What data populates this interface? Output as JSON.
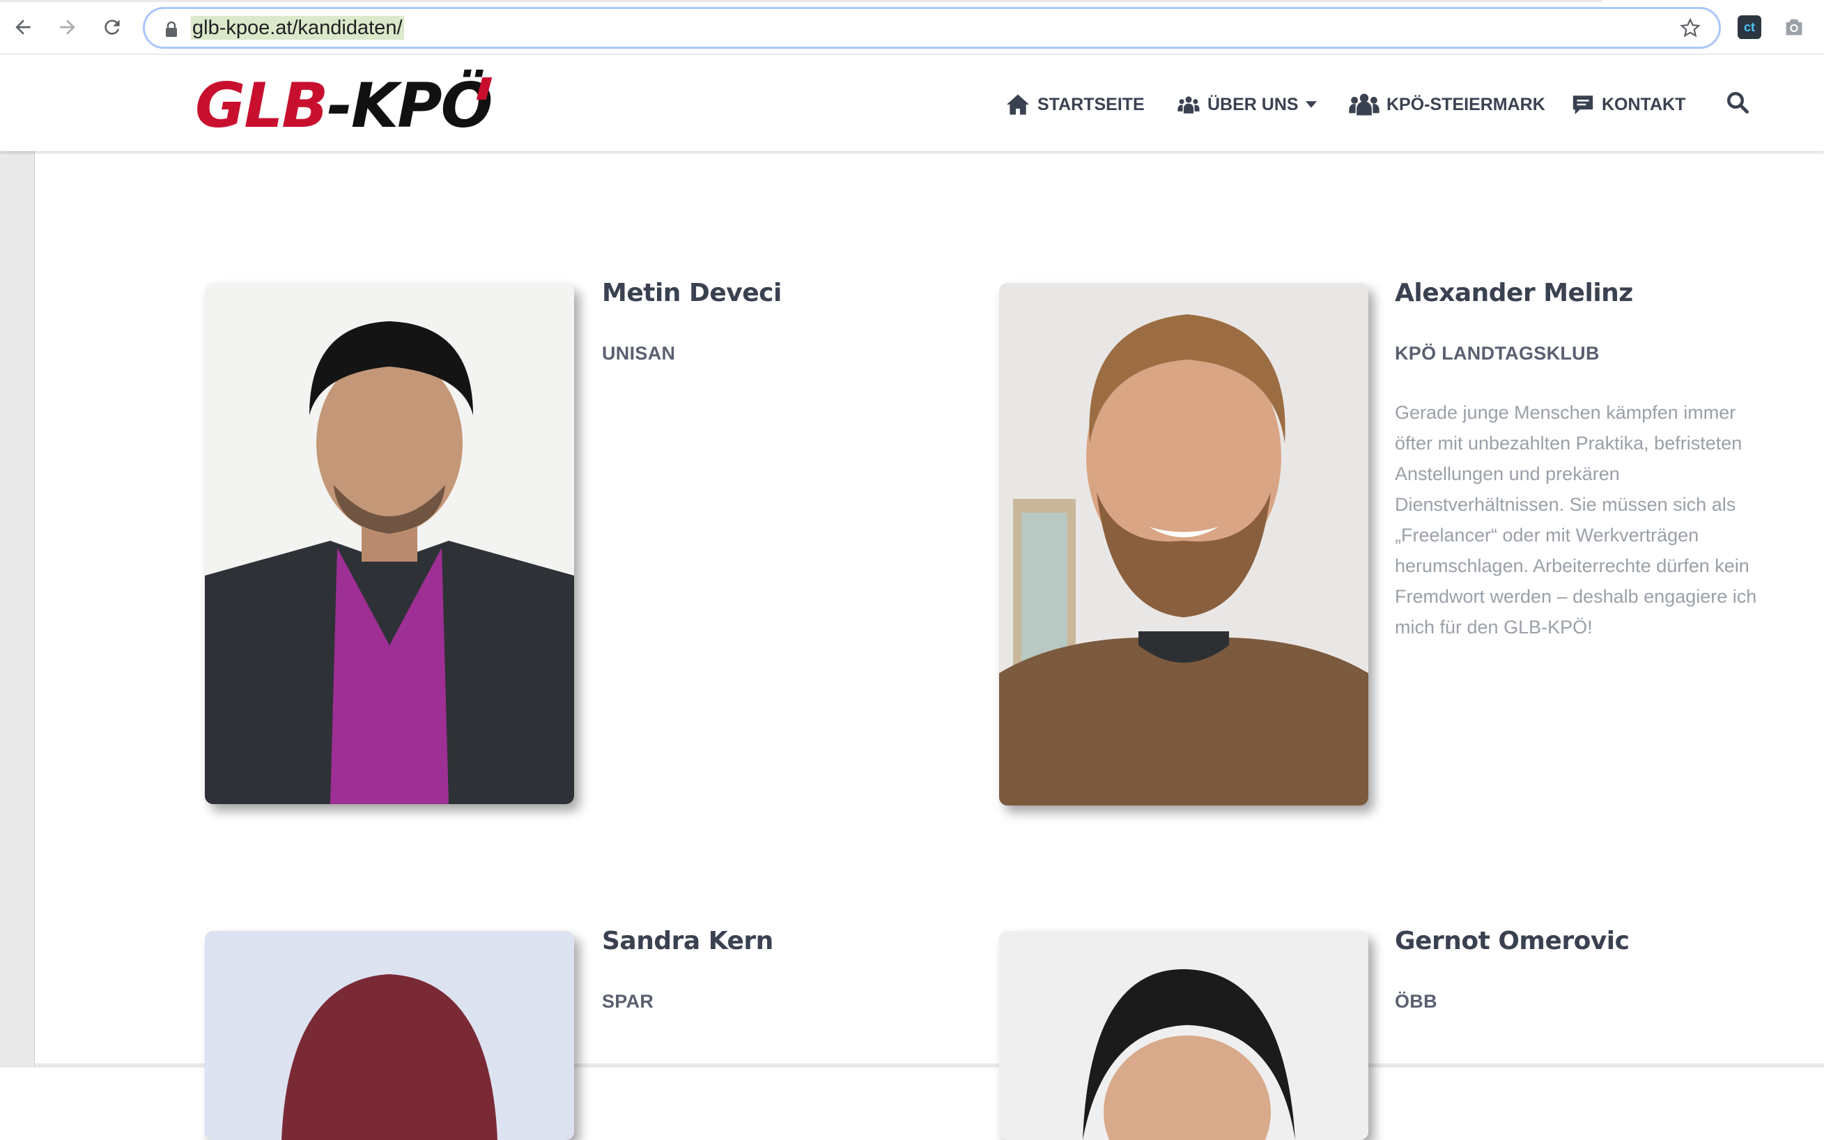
{
  "browser": {
    "url": "glb-kpoe.at/kandidaten/",
    "ext_label": "ct"
  },
  "logo": {
    "part1": "GLB",
    "part2": "-KPÖ"
  },
  "menu": {
    "home": "STARTSEITE",
    "about": "ÜBER UNS",
    "styria": "KPÖ-STEIERMARK",
    "contact": "KONTAKT"
  },
  "candidates": [
    {
      "name": "Metin Deveci",
      "org": "UNISAN",
      "bio": ""
    },
    {
      "name": "Alexander Melinz",
      "org": "KPÖ LANDTAGSKLUB",
      "bio": "Gerade junge Menschen kämpfen immer öfter mit unbezahlten Praktika, befristeten Anstellungen und prekären Dienstverhältnissen. Sie müssen sich als „Freelancer“ oder mit Werkverträgen herumschlagen. Arbeiterrechte dürfen kein Fremdwort werden – deshalb engagiere ich mich für den GLB-KPÖ!"
    },
    {
      "name": "Sandra Kern",
      "org": "SPAR",
      "bio": ""
    },
    {
      "name": "Gernot Omerovic",
      "org": "ÖBB",
      "bio": ""
    }
  ],
  "colors": {
    "brand_red": "#c8102e",
    "heading": "#3a4150",
    "body_text": "#9aa0a8"
  }
}
